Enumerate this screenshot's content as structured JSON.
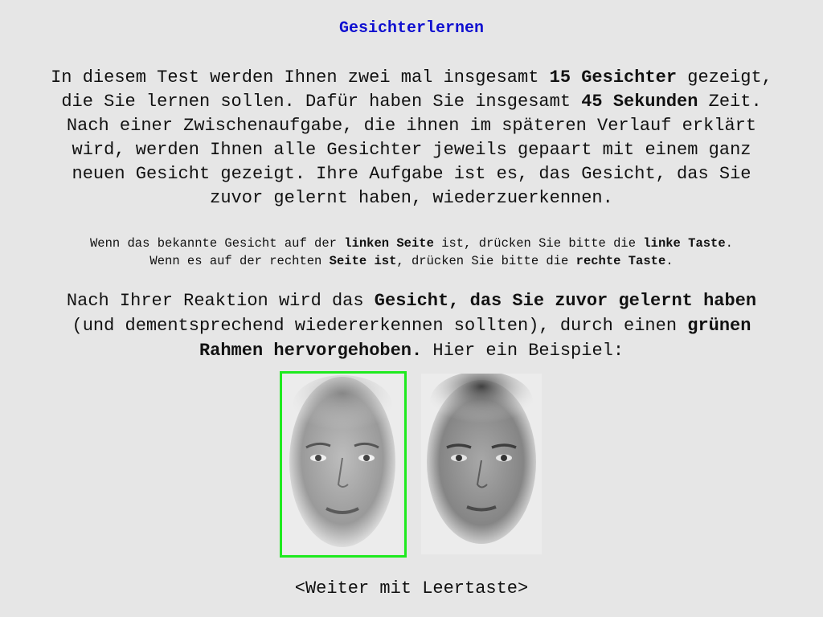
{
  "title": "Gesichterlernen",
  "intro": {
    "l1_a": "In diesem Test werden Ihnen zwei mal insgesamt ",
    "l1_b": "15 Gesichter",
    "l1_c": " gezeigt,",
    "l2_a": "die Sie lernen sollen. Dafür haben Sie insgesamt ",
    "l2_b": "45 Sekunden",
    "l2_c": " Zeit.",
    "l3": "Nach einer Zwischenaufgabe, die ihnen im späteren Verlauf erklärt",
    "l4": "wird, werden Ihnen alle Gesichter jeweils gepaart mit einem ganz",
    "l5": "neuen Gesicht gezeigt. Ihre Aufgabe ist es, das Gesicht, das Sie",
    "l6": "zuvor gelernt haben, wiederzuerkennen."
  },
  "keys": {
    "l1_a": "Wenn das bekannte Gesicht auf der ",
    "l1_b": "linken Seite",
    "l1_c": " ist, drücken Sie bitte die ",
    "l1_d": "linke Taste",
    "l1_e": ".",
    "l2_a": "Wenn es auf der rechten ",
    "l2_b": "Seite ist",
    "l2_c": ", drücken Sie bitte die ",
    "l2_d": "rechte Taste",
    "l2_e": "."
  },
  "reaction": {
    "l1_a": "Nach Ihrer Reaktion wird das ",
    "l1_b": "Gesicht, das Sie zuvor gelernt haben",
    "l2_a": "(und dementsprechend wiedererkennen sollten), durch einen ",
    "l2_b": "grünen",
    "l3_a": "Rahmen hervorgehoben.",
    "l3_b": " Hier ein Beispiel:"
  },
  "example": {
    "highlight_color": "#1eea1e",
    "left_face": "face-photo",
    "right_face": "face-photo"
  },
  "continue_prompt": "<Weiter mit Leertaste>"
}
